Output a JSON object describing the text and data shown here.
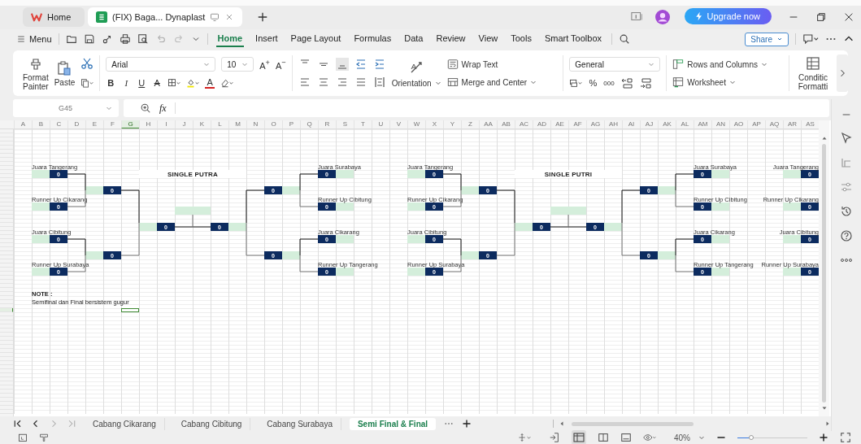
{
  "app_tabs": [
    {
      "kind": "home",
      "label": "Home",
      "selected": false
    },
    {
      "kind": "sheet",
      "label": "(FIX) Baga... Dynaplast",
      "selected": true
    }
  ],
  "upgrade_button": "Upgrade now",
  "menu_button": "Menu",
  "menu_tabs": [
    {
      "label": "Home",
      "selected": true
    },
    {
      "label": "Insert",
      "selected": false
    },
    {
      "label": "Page Layout",
      "selected": false
    },
    {
      "label": "Formulas",
      "selected": false
    },
    {
      "label": "Data",
      "selected": false
    },
    {
      "label": "Review",
      "selected": false
    },
    {
      "label": "View",
      "selected": false
    },
    {
      "label": "Tools",
      "selected": false
    },
    {
      "label": "Smart Toolbox",
      "selected": false
    }
  ],
  "share_button": "Share",
  "ribbon": {
    "format_painter": "Format Painter",
    "paste": "Paste",
    "font": "Arial",
    "font_size": "10",
    "grow_font": "A$^{+}$",
    "shrink_font": "A$^{−}$",
    "bold": "B",
    "italic": "I",
    "underline": "U",
    "strikethrough": "A",
    "font_color": "A",
    "orientation": "Orientation",
    "wrap_text": "Wrap Text",
    "merge_and_center": "Merge and Center",
    "number_format": "General",
    "percent": "%",
    "thousands": "000",
    "rows_and_columns": "Rows and Columns",
    "worksheet": "Worksheet",
    "conditional_formatting": "Conditic Formatti"
  },
  "formula_bar": {
    "name_box": "G45",
    "function_label": "fx"
  },
  "sheet": {
    "columns": [
      {
        "label": "A",
        "selected": false
      },
      {
        "label": "B",
        "selected": false
      },
      {
        "label": "C",
        "selected": false
      },
      {
        "label": "D",
        "selected": false
      },
      {
        "label": "E",
        "selected": false
      },
      {
        "label": "F",
        "selected": false
      },
      {
        "label": "G",
        "selected": true
      },
      {
        "label": "H",
        "selected": false
      },
      {
        "label": "I",
        "selected": false
      },
      {
        "label": "J",
        "selected": false
      },
      {
        "label": "K",
        "selected": false
      },
      {
        "label": "L",
        "selected": false
      },
      {
        "label": "M",
        "selected": false
      },
      {
        "label": "N",
        "selected": false
      },
      {
        "label": "O",
        "selected": false
      },
      {
        "label": "P",
        "selected": false
      },
      {
        "label": "Q",
        "selected": false
      },
      {
        "label": "R",
        "selected": false
      },
      {
        "label": "S",
        "selected": false
      },
      {
        "label": "T",
        "selected": false
      },
      {
        "label": "U",
        "selected": false
      },
      {
        "label": "V",
        "selected": false
      },
      {
        "label": "W",
        "selected": false
      },
      {
        "label": "X",
        "selected": false
      },
      {
        "label": "Y",
        "selected": false
      },
      {
        "label": "Z",
        "selected": false
      },
      {
        "label": "AA",
        "selected": false
      },
      {
        "label": "AB",
        "selected": false
      },
      {
        "label": "AC",
        "selected": false
      },
      {
        "label": "AD",
        "selected": false
      },
      {
        "label": "AE",
        "selected": false
      },
      {
        "label": "AF",
        "selected": false
      },
      {
        "label": "AG",
        "selected": false
      },
      {
        "label": "AH",
        "selected": false
      },
      {
        "label": "AI",
        "selected": false
      },
      {
        "label": "AJ",
        "selected": false
      },
      {
        "label": "AK",
        "selected": false
      },
      {
        "label": "AL",
        "selected": false
      },
      {
        "label": "AM",
        "selected": false
      },
      {
        "label": "AN",
        "selected": false
      },
      {
        "label": "AO",
        "selected": false
      },
      {
        "label": "AP",
        "selected": false
      },
      {
        "label": "AQ",
        "selected": false
      },
      {
        "label": "AR",
        "selected": false
      },
      {
        "label": "AS",
        "selected": false
      }
    ],
    "rows": [
      {
        "selected": false
      },
      {
        "selected": false
      },
      {
        "selected": false
      },
      {
        "selected": false
      },
      {
        "selected": false
      },
      {
        "selected": false
      },
      {
        "selected": false
      },
      {
        "selected": false
      },
      {
        "selected": false
      },
      {
        "selected": false
      },
      {
        "selected": false
      },
      {
        "selected": false
      },
      {
        "selected": false
      },
      {
        "selected": false
      },
      {
        "selected": false
      },
      {
        "selected": false
      },
      {
        "selected": false
      },
      {
        "selected": false
      },
      {
        "selected": false
      },
      {
        "selected": false
      },
      {
        "selected": false
      },
      {
        "selected": false
      },
      {
        "selected": false
      },
      {
        "selected": false
      },
      {
        "selected": false
      },
      {
        "selected": false
      },
      {
        "selected": false
      },
      {
        "selected": false
      },
      {
        "selected": false
      },
      {
        "selected": false
      },
      {
        "selected": false
      },
      {
        "selected": false
      },
      {
        "selected": false
      },
      {
        "selected": false
      },
      {
        "selected": false
      },
      {
        "selected": false
      },
      {
        "selected": false
      },
      {
        "selected": false
      },
      {
        "selected": false
      },
      {
        "selected": false
      },
      {
        "selected": false
      },
      {
        "selected": false
      },
      {
        "selected": false
      },
      {
        "selected": false
      },
      {
        "selected": true
      },
      {
        "selected": false
      },
      {
        "selected": false
      },
      {
        "selected": false
      },
      {
        "selected": false
      },
      {
        "selected": false
      },
      {
        "selected": false
      },
      {
        "selected": false
      },
      {
        "selected": false
      },
      {
        "selected": false
      },
      {
        "selected": false
      },
      {
        "selected": false
      },
      {
        "selected": false
      },
      {
        "selected": false
      },
      {
        "selected": false
      },
      {
        "selected": false
      },
      {
        "selected": false
      },
      {
        "selected": false
      },
      {
        "selected": false
      },
      {
        "selected": false
      },
      {
        "selected": false
      },
      {
        "selected": false
      },
      {
        "selected": false
      },
      {
        "selected": false
      },
      {
        "selected": false
      },
      {
        "selected": false
      }
    ],
    "brackets": [
      {
        "title": "SINGLE PUTRA",
        "left_entries": [
          {
            "label": "Juara Tangerang",
            "score": "0"
          },
          {
            "label": "Runner Up Cikarang",
            "score": "0"
          },
          {
            "label": "Juara Cibitung",
            "score": "0"
          },
          {
            "label": "Runner Up Surabaya",
            "score": "0"
          }
        ],
        "left_semis": [
          "0",
          "0"
        ],
        "finals": [
          "0",
          "0"
        ],
        "right_semis": [
          "0",
          "0"
        ],
        "right_entries": [
          {
            "label": "Juara Surabaya",
            "score": "0"
          },
          {
            "label": "Runner Up Cibitung",
            "score": "0"
          },
          {
            "label": "Juara Cikarang",
            "score": "0"
          },
          {
            "label": "Runner Up Tangerang",
            "score": "0"
          }
        ]
      },
      {
        "title": "SINGLE PUTRI",
        "left_entries": [
          {
            "label": "Juara Tangerang",
            "score": "0"
          },
          {
            "label": "Runner Up Cikarang",
            "score": "0"
          },
          {
            "label": "Juara Cibitung",
            "score": "0"
          },
          {
            "label": "Runner Up Surabaya",
            "score": "0"
          }
        ],
        "left_semis": [
          "0",
          "0"
        ],
        "finals": [
          "0",
          "0"
        ],
        "right_semis": [
          "0",
          "0"
        ],
        "right_entries": [
          {
            "label": "Juara Surabaya",
            "score": "0"
          },
          {
            "label": "Runner Up Cibitung",
            "score": "0"
          },
          {
            "label": "Juara Cikarang",
            "score": "0"
          },
          {
            "label": "Runner Up Tangerang",
            "score": "0"
          }
        ]
      },
      {
        "left_entries": [
          {
            "label": "Juara Tangerang",
            "score": "0"
          },
          {
            "label": "Runner Up Cikarang",
            "score": "0"
          },
          {
            "label": "Juara Cibitung",
            "score": "0"
          },
          {
            "label": "Runner Up Surabaya",
            "score": "0"
          }
        ]
      }
    ],
    "note": {
      "title": "NOTE :",
      "text": "Semifinal dan Final bersistem gugur"
    }
  },
  "sheet_tabs": [
    {
      "label": "Cabang Cikarang",
      "selected": false
    },
    {
      "label": "Cabang Cibitung",
      "selected": false
    },
    {
      "label": "Cabang Surabaya",
      "selected": false
    },
    {
      "label": "Semi Final & Final",
      "selected": true
    }
  ],
  "status_bar": {
    "zoom": "40%",
    "zoom_slider": {
      "level": 0.2
    }
  }
}
